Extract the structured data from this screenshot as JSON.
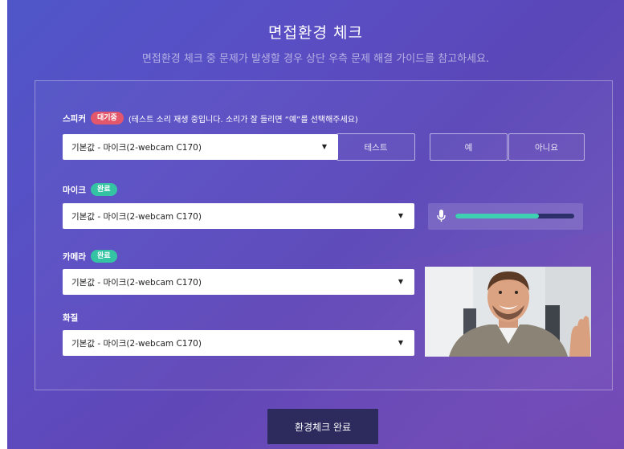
{
  "header": {
    "title": "면접환경 체크",
    "subtitle": "면접환경 체크 중 문제가 발생할 경우 상단 우측 문제 해결 가이드를 참고하세요."
  },
  "speaker": {
    "label": "스피커",
    "badge": "대기중",
    "hint": "(테스트 소리 재생 중입니다. 소리가 잘 들리면 “예”를 선택해주세요)",
    "selected": "기본값 - 마이크(2-webcam C170)",
    "test_label": "테스트",
    "yes_label": "예",
    "no_label": "아니요"
  },
  "mic": {
    "label": "마이크",
    "badge": "완료",
    "selected": "기본값 - 마이크(2-webcam C170)",
    "level": 0.7
  },
  "camera": {
    "label": "카메라",
    "badge": "완료",
    "selected": "기본값 - 마이크(2-webcam C170)"
  },
  "quality": {
    "label": "화질",
    "selected": "기본값 - 마이크(2-webcam C170)"
  },
  "footer": {
    "submit_label": "환경체크 완료"
  },
  "colors": {
    "badge_waiting": "#e2576b",
    "badge_done": "#35c4a3",
    "meter_fill": "#3fcfb3",
    "submit_bg": "#2d2a5e"
  },
  "icons": [
    "chevron-down-icon",
    "microphone-icon"
  ]
}
